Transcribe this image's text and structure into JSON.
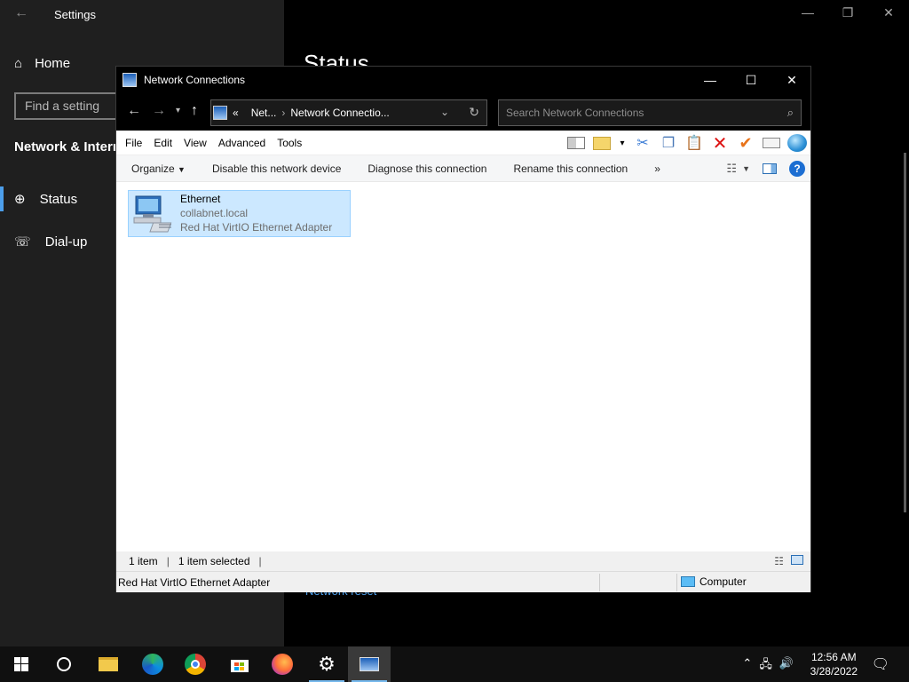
{
  "settings": {
    "title": "Settings",
    "home_label": "Home",
    "search_placeholder": "Find a setting",
    "section_title": "Network & Internet",
    "nav": [
      {
        "label": "Status"
      },
      {
        "label": "Dial-up"
      }
    ],
    "page_heading": "Status",
    "network_reset_link": "Network reset"
  },
  "explorer": {
    "title": "Network Connections",
    "breadcrumb_prefix": "«",
    "breadcrumb": [
      "Net...",
      "Network Connectio..."
    ],
    "search_placeholder": "Search Network Connections",
    "menu": [
      "File",
      "Edit",
      "View",
      "Advanced",
      "Tools"
    ],
    "commands": {
      "organize": "Organize",
      "disable": "Disable this network device",
      "diagnose": "Diagnose this connection",
      "rename": "Rename this connection",
      "more": "»"
    },
    "items": [
      {
        "name": "Ethernet",
        "network": "collabnet.local",
        "adapter": "Red Hat VirtIO Ethernet Adapter"
      }
    ],
    "statusbar": {
      "count": "1 item",
      "selected": "1 item selected"
    },
    "details": {
      "description": "Red Hat VirtIO Ethernet Adapter",
      "location": "Computer"
    }
  },
  "taskbar": {
    "time": "12:56 AM",
    "date": "3/28/2022",
    "apps": [
      "start-icon",
      "cortana-icon",
      "file-explorer-icon",
      "edge-icon",
      "chrome-icon",
      "store-icon",
      "firefox-icon",
      "settings-icon",
      "network-connections-icon"
    ]
  },
  "colors": {
    "accent": "#4c9eea",
    "selection": "#cce8ff",
    "taskbar": "#101010"
  }
}
